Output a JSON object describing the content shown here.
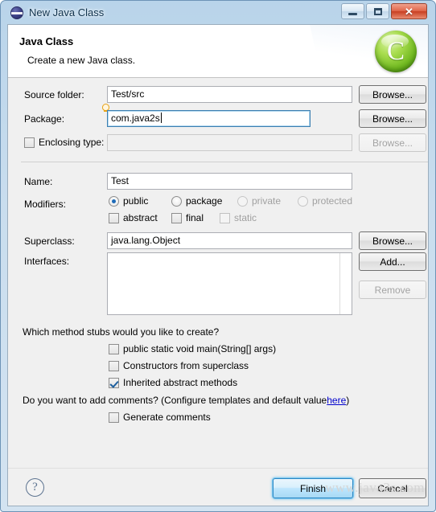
{
  "window": {
    "title": "New Java Class",
    "icon": "eclipse-sphere-icon",
    "minimize_glyph": "minimize-icon",
    "maximize_glyph": "maximize-icon",
    "close_glyph": "✕"
  },
  "banner": {
    "title": "Java Class",
    "subtitle": "Create a new Java class.",
    "logo_letter": "C",
    "logo_color": "#6fb81f"
  },
  "form": {
    "source_folder": {
      "label": "Source folder:",
      "value": "Test/src",
      "browse": "Browse...",
      "browse_enabled": true
    },
    "package": {
      "label": "Package:",
      "value": "com.java2s",
      "browse": "Browse...",
      "browse_enabled": true,
      "focused": true,
      "hint_icon": "lightbulb-icon"
    },
    "enclosing_type": {
      "label": "Enclosing type:",
      "value": "",
      "checked": false,
      "enabled": false,
      "browse": "Browse...",
      "browse_enabled": false
    },
    "name": {
      "label": "Name:",
      "value": "Test"
    },
    "modifiers": {
      "label": "Modifiers:",
      "radios": [
        {
          "label": "public",
          "selected": true,
          "enabled": true
        },
        {
          "label": "package",
          "selected": false,
          "enabled": true
        },
        {
          "label": "private",
          "selected": false,
          "enabled": false
        },
        {
          "label": "protected",
          "selected": false,
          "enabled": false
        }
      ],
      "checkboxes": [
        {
          "label": "abstract",
          "checked": false,
          "enabled": true
        },
        {
          "label": "final",
          "checked": false,
          "enabled": true
        },
        {
          "label": "static",
          "checked": false,
          "enabled": false
        }
      ]
    },
    "superclass": {
      "label": "Superclass:",
      "value": "java.lang.Object",
      "browse": "Browse...",
      "browse_enabled": true
    },
    "interfaces": {
      "label": "Interfaces:",
      "items": [],
      "add": "Add...",
      "add_enabled": true,
      "remove": "Remove",
      "remove_enabled": false
    }
  },
  "stubs": {
    "question": "Which method stubs would you like to create?",
    "options": [
      {
        "label": "public static void main(String[] args)",
        "checked": false
      },
      {
        "label": "Constructors from superclass",
        "checked": false
      },
      {
        "label": "Inherited abstract methods",
        "checked": true
      }
    ]
  },
  "comments": {
    "question_prefix": "Do you want to add comments? (Configure templates and default value ",
    "link": "here",
    "question_suffix": ")",
    "option": {
      "label": "Generate comments",
      "checked": false
    }
  },
  "footer": {
    "help_glyph": "?",
    "finish": "Finish",
    "cancel": "Cancel",
    "watermark": "www.java2s.com"
  }
}
